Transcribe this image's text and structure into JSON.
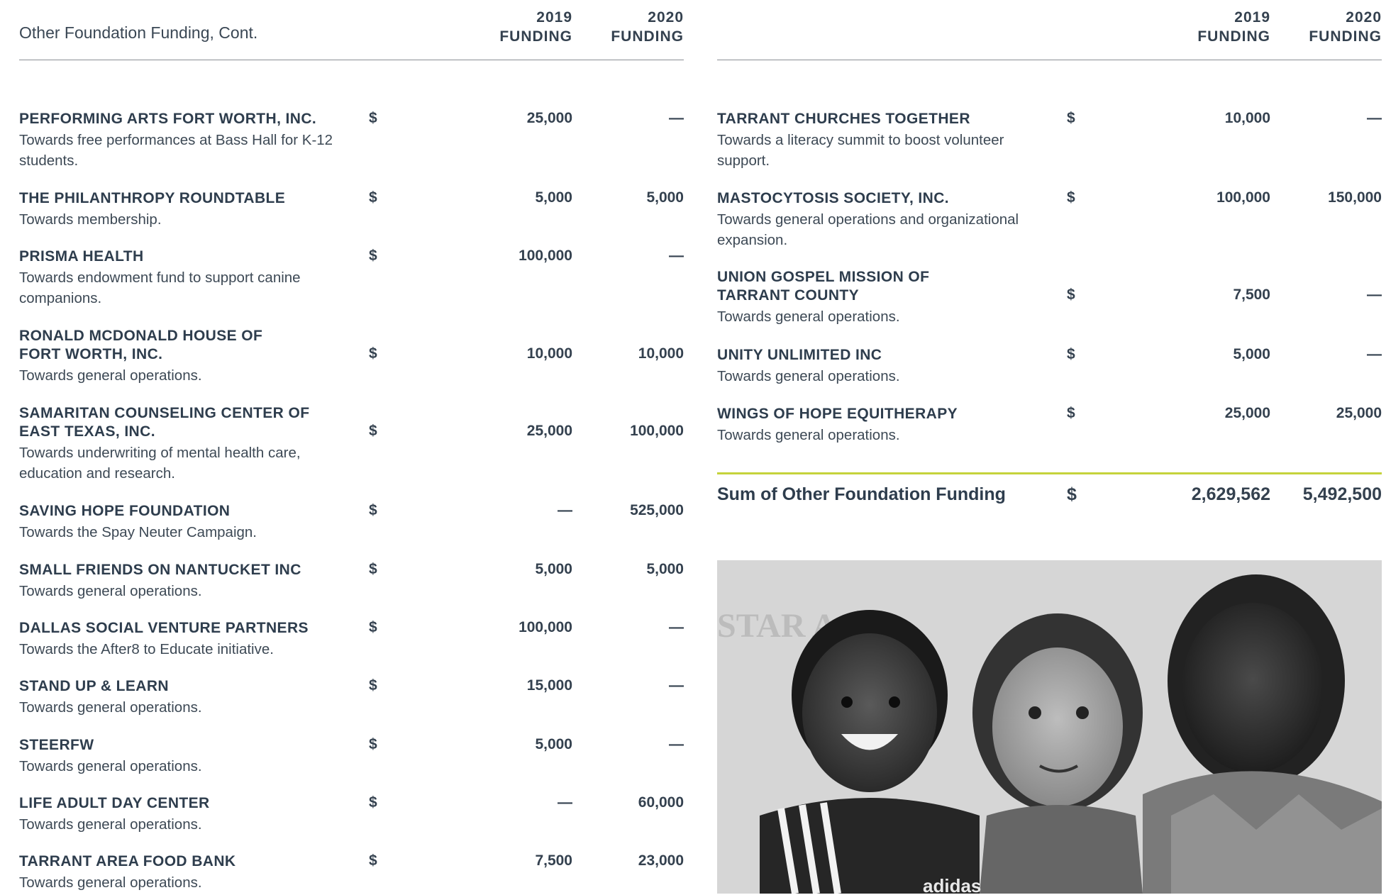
{
  "left": {
    "title": "Other Foundation Funding, Cont.",
    "col_2019": [
      "2019",
      "FUNDING"
    ],
    "col_2020": [
      "2020",
      "FUNDING"
    ],
    "rows": [
      {
        "name": "PERFORMING ARTS FORT WORTH, INC.",
        "desc": "Towards free performances at Bass Hall for K-12 students.",
        "cur": "$",
        "v2019": "25,000",
        "v2020": "—"
      },
      {
        "name": "THE PHILANTHROPY ROUNDTABLE",
        "desc": "Towards membership.",
        "cur": "$",
        "v2019": "5,000",
        "v2020": "5,000"
      },
      {
        "name": "PRISMA HEALTH",
        "desc": "Towards endowment fund to support canine companions.",
        "cur": "$",
        "v2019": "100,000",
        "v2020": "—"
      },
      {
        "name": "RONALD MCDONALD HOUSE OF FORT WORTH, INC.",
        "desc": "Towards general operations.",
        "cur": "$",
        "v2019": "10,000",
        "v2020": "10,000"
      },
      {
        "name": "SAMARITAN COUNSELING CENTER OF EAST TEXAS, INC.",
        "desc": "Towards underwriting of mental health care, education and research.",
        "cur": "$",
        "v2019": "25,000",
        "v2020": "100,000"
      },
      {
        "name": "SAVING HOPE FOUNDATION",
        "desc": "Towards the Spay Neuter Campaign.",
        "cur": "$",
        "v2019": "—",
        "v2020": "525,000"
      },
      {
        "name": "SMALL FRIENDS ON NANTUCKET INC",
        "desc": "Towards general operations.",
        "cur": "$",
        "v2019": "5,000",
        "v2020": "5,000"
      },
      {
        "name": "DALLAS SOCIAL VENTURE PARTNERS",
        "desc": "Towards the After8 to Educate initiative.",
        "cur": "$",
        "v2019": "100,000",
        "v2020": "—"
      },
      {
        "name": "STAND UP & LEARN",
        "desc": "Towards general operations.",
        "cur": "$",
        "v2019": "15,000",
        "v2020": "—"
      },
      {
        "name": "STEERFW",
        "desc": "Towards general operations.",
        "cur": "$",
        "v2019": "5,000",
        "v2020": "—"
      },
      {
        "name": "LIFE ADULT DAY CENTER",
        "desc": "Towards general operations.",
        "cur": "$",
        "v2019": "—",
        "v2020": "60,000"
      },
      {
        "name": "TARRANT AREA FOOD BANK",
        "desc": "Towards general operations.",
        "cur": "$",
        "v2019": "7,500",
        "v2020": "23,000"
      }
    ]
  },
  "right": {
    "col_2019": [
      "2019",
      "FUNDING"
    ],
    "col_2020": [
      "2020",
      "FUNDING"
    ],
    "rows": [
      {
        "name": "TARRANT CHURCHES TOGETHER",
        "desc": "Towards a literacy summit to boost volunteer support.",
        "cur": "$",
        "v2019": "10,000",
        "v2020": "—"
      },
      {
        "name": "MASTOCYTOSIS SOCIETY, INC.",
        "desc": "Towards general operations and organizational expansion.",
        "cur": "$",
        "v2019": "100,000",
        "v2020": "150,000"
      },
      {
        "name": "UNION GOSPEL MISSION OF TARRANT COUNTY",
        "desc": "Towards general operations.",
        "cur": "$",
        "v2019": "7,500",
        "v2020": "—"
      },
      {
        "name": "UNITY UNLIMITED INC",
        "desc": "Towards general operations.",
        "cur": "$",
        "v2019": "5,000",
        "v2020": "—"
      },
      {
        "name": "WINGS OF HOPE EQUITHERAPY",
        "desc": "Towards general operations.",
        "cur": "$",
        "v2019": "25,000",
        "v2020": "25,000"
      }
    ],
    "sum": {
      "label": "Sum of Other Foundation Funding",
      "cur": "$",
      "v2019": "2,629,562",
      "v2020": "5,492,500"
    },
    "photo": {
      "banner_text": "STAR A",
      "shirt_text": "adidas"
    }
  },
  "colors": {
    "text": "#2e3d4d",
    "rule": "#8a8f94",
    "accent": "#c5d33b"
  }
}
